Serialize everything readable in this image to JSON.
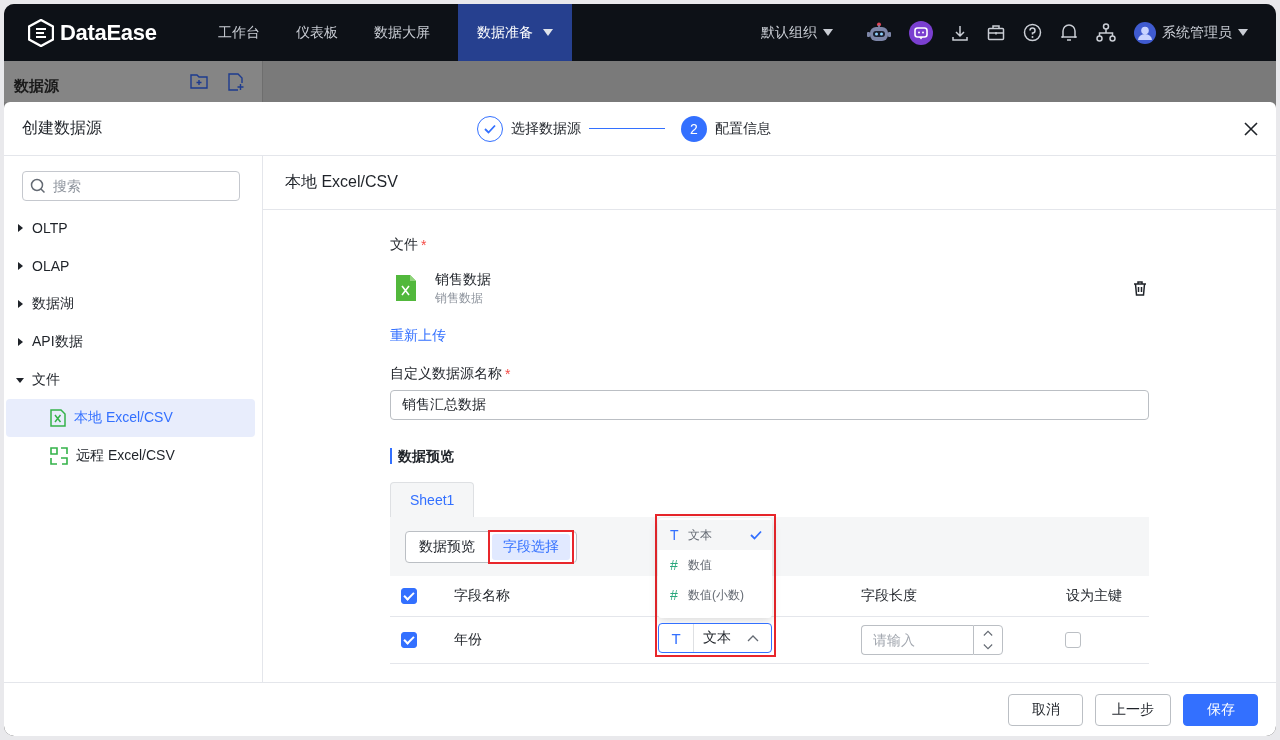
{
  "navbar": {
    "logo": "DataEase",
    "menu": [
      {
        "label": "工作台",
        "selected": false,
        "dropdown": false
      },
      {
        "label": "仪表板",
        "selected": false,
        "dropdown": false
      },
      {
        "label": "数据大屏",
        "selected": false,
        "dropdown": false
      },
      {
        "label": "数据准备",
        "selected": true,
        "dropdown": true
      }
    ],
    "org": "默认组织",
    "user": "系统管理员"
  },
  "background_panel": {
    "title": "数据源"
  },
  "dialog": {
    "title": "创建数据源",
    "steps": [
      {
        "label": "选择数据源",
        "kind": "done"
      },
      {
        "number": "2",
        "label": "配置信息",
        "kind": "active"
      }
    ]
  },
  "sidebar": {
    "search": {
      "placeholder": "搜索"
    },
    "tree": [
      {
        "label": "OLTP",
        "expanded": false
      },
      {
        "label": "OLAP",
        "expanded": false
      },
      {
        "label": "数据湖",
        "expanded": false
      },
      {
        "label": "API数据",
        "expanded": false
      },
      {
        "label": "文件",
        "expanded": true,
        "children": [
          {
            "label": "本地 Excel/CSV",
            "kind": "local",
            "selected": true
          },
          {
            "label": "远程 Excel/CSV",
            "kind": "remote",
            "selected": false
          }
        ]
      }
    ]
  },
  "content": {
    "title": "本地 Excel/CSV",
    "file_label": {
      "label": "文件",
      "required_mark": "*"
    },
    "file": {
      "name": "销售数据",
      "subtitle": "销售数据"
    },
    "reupload": "重新上传",
    "name_field": {
      "label": "自定义数据源名称",
      "required_mark": "*",
      "value": "销售汇总数据"
    },
    "section_title": "数据预览",
    "sheet_tabs": [
      {
        "label": "Sheet1",
        "selected": true
      }
    ],
    "view_toggle": [
      {
        "label": "数据预览",
        "selected": false
      },
      {
        "label": "字段选择",
        "selected": true
      }
    ],
    "table": {
      "header_checked": true,
      "columns": [
        "字段名称",
        "字段长度",
        "设为主键"
      ],
      "rows": [
        {
          "checked": true,
          "name": "年份",
          "type_icon": "T",
          "type": "文本",
          "open": true,
          "length_placeholder": "请输入",
          "primary_key": false
        }
      ]
    },
    "type_dropdown": {
      "options": [
        {
          "icon": "T",
          "label": "文本",
          "kind": "text",
          "selected": true
        },
        {
          "icon": "#",
          "label": "数值",
          "kind": "number",
          "selected": false
        },
        {
          "icon": "#",
          "label": "数值(小数)",
          "kind": "number",
          "selected": false
        }
      ]
    }
  },
  "footer": {
    "buttons": [
      {
        "label": "取消",
        "kind": "default"
      },
      {
        "label": "上一步",
        "kind": "default"
      },
      {
        "label": "保存",
        "kind": "primary"
      }
    ]
  }
}
